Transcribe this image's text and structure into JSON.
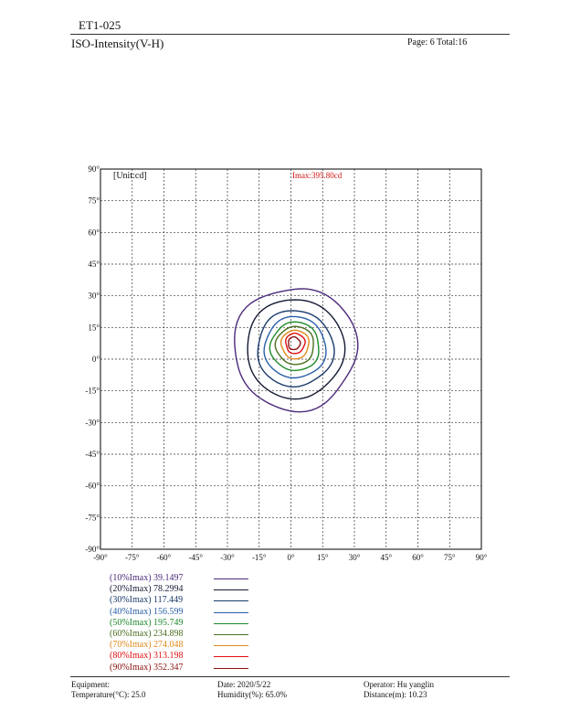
{
  "header": {
    "doc_id": "ET1-025",
    "subtitle": "ISO-Intensity(V-H)",
    "page_info": "Page: 6  Total:16"
  },
  "chart_data": {
    "type": "contour",
    "title": "",
    "unit_label": "[Unit:cd]",
    "imax_label": "Imax:395.80cd",
    "imax_value": 395.8,
    "xlim": [
      -90,
      90
    ],
    "ylim": [
      -90,
      90
    ],
    "x_ticks": [
      "-90°",
      "-75°",
      "-60°",
      "-45°",
      "-30°",
      "-15°",
      "0°",
      "15°",
      "30°",
      "45°",
      "60°",
      "75°",
      "90°"
    ],
    "y_ticks": [
      "90°",
      "75°",
      "60°",
      "45°",
      "30°",
      "15°",
      "0°",
      "-15°",
      "-30°",
      "-45°",
      "-60°",
      "-75°",
      "-90°"
    ],
    "grid": true,
    "series": [
      {
        "name": "(10%Imax) 39.1497",
        "color": "#4b2a7a",
        "cx": 2,
        "cy": 5,
        "rx": 29,
        "ry": 29,
        "wobble": 0.05
      },
      {
        "name": "(20%Imax) 78.2994",
        "color": "#141a33",
        "cx": 2,
        "cy": 5,
        "rx": 23,
        "ry": 23.5,
        "wobble": 0.03
      },
      {
        "name": "(30%Imax) 117.449",
        "color": "#1a3a6b",
        "cx": 2,
        "cy": 5,
        "rx": 18,
        "ry": 18,
        "wobble": 0.04
      },
      {
        "name": "(40%Imax) 156.599",
        "color": "#2a60a8",
        "cx": 2,
        "cy": 5.5,
        "rx": 14.5,
        "ry": 14.5,
        "wobble": 0.04
      },
      {
        "name": "(50%Imax) 195.749",
        "color": "#1f8a2a",
        "cx": 2,
        "cy": 6,
        "rx": 11.5,
        "ry": 11.5,
        "wobble": 0.05
      },
      {
        "name": "(60%Imax) 234.898",
        "color": "#4a6e1f",
        "cx": 2,
        "cy": 6.5,
        "rx": 9,
        "ry": 9,
        "wobble": 0.05
      },
      {
        "name": "(70%Imax) 274.048",
        "color": "#e08a1c",
        "cx": 2,
        "cy": 7,
        "rx": 6.5,
        "ry": 6.8,
        "wobble": 0.06
      },
      {
        "name": "(80%Imax) 313.198",
        "color": "#e01010",
        "cx": 2,
        "cy": 7.5,
        "rx": 4.5,
        "ry": 4.8,
        "wobble": 0.07
      },
      {
        "name": "(90%Imax) 352.347",
        "color": "#8a1010",
        "cx": 1.5,
        "cy": 7.5,
        "rx": 2.8,
        "ry": 3.0,
        "wobble": 0.08
      }
    ]
  },
  "footer": {
    "equipment": "Equipment:",
    "temperature": "Temperature(°C): 25.0",
    "date": "Date: 2020/5/22",
    "humidity": "Humidity(%): 65.0%",
    "operator": "Operator: Hu yanglin",
    "distance": "Distance(m): 10.23"
  }
}
